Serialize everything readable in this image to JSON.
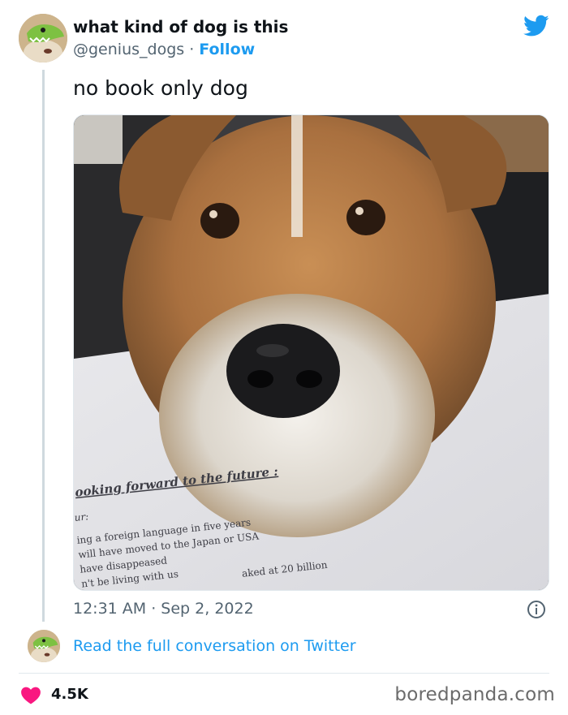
{
  "tweet": {
    "display_name": "what kind of dog is this",
    "handle": "@genius_dogs",
    "separator": " · ",
    "follow_label": "Follow",
    "text": "no book only dog",
    "timestamp": "12:31 AM · Sep 2, 2022",
    "read_full": "Read the full conversation on Twitter",
    "like_count": "4.5K"
  },
  "photo": {
    "paper_lines": [
      "ooking forward to the future :",
      "ur:",
      "ing a foreign language in five years",
      "will have moved to the Japan or USA",
      "have disappeased",
      "n't be living with us",
      "aked at 20 billion"
    ]
  },
  "footer": {
    "watermark": "boredpanda.com"
  },
  "colors": {
    "accent": "#1d9bf0",
    "like_heart": "#f91880",
    "secondary_text": "#536471"
  },
  "icons": {
    "brand": "twitter-bird-icon",
    "info": "info-icon",
    "like": "heart-icon"
  }
}
